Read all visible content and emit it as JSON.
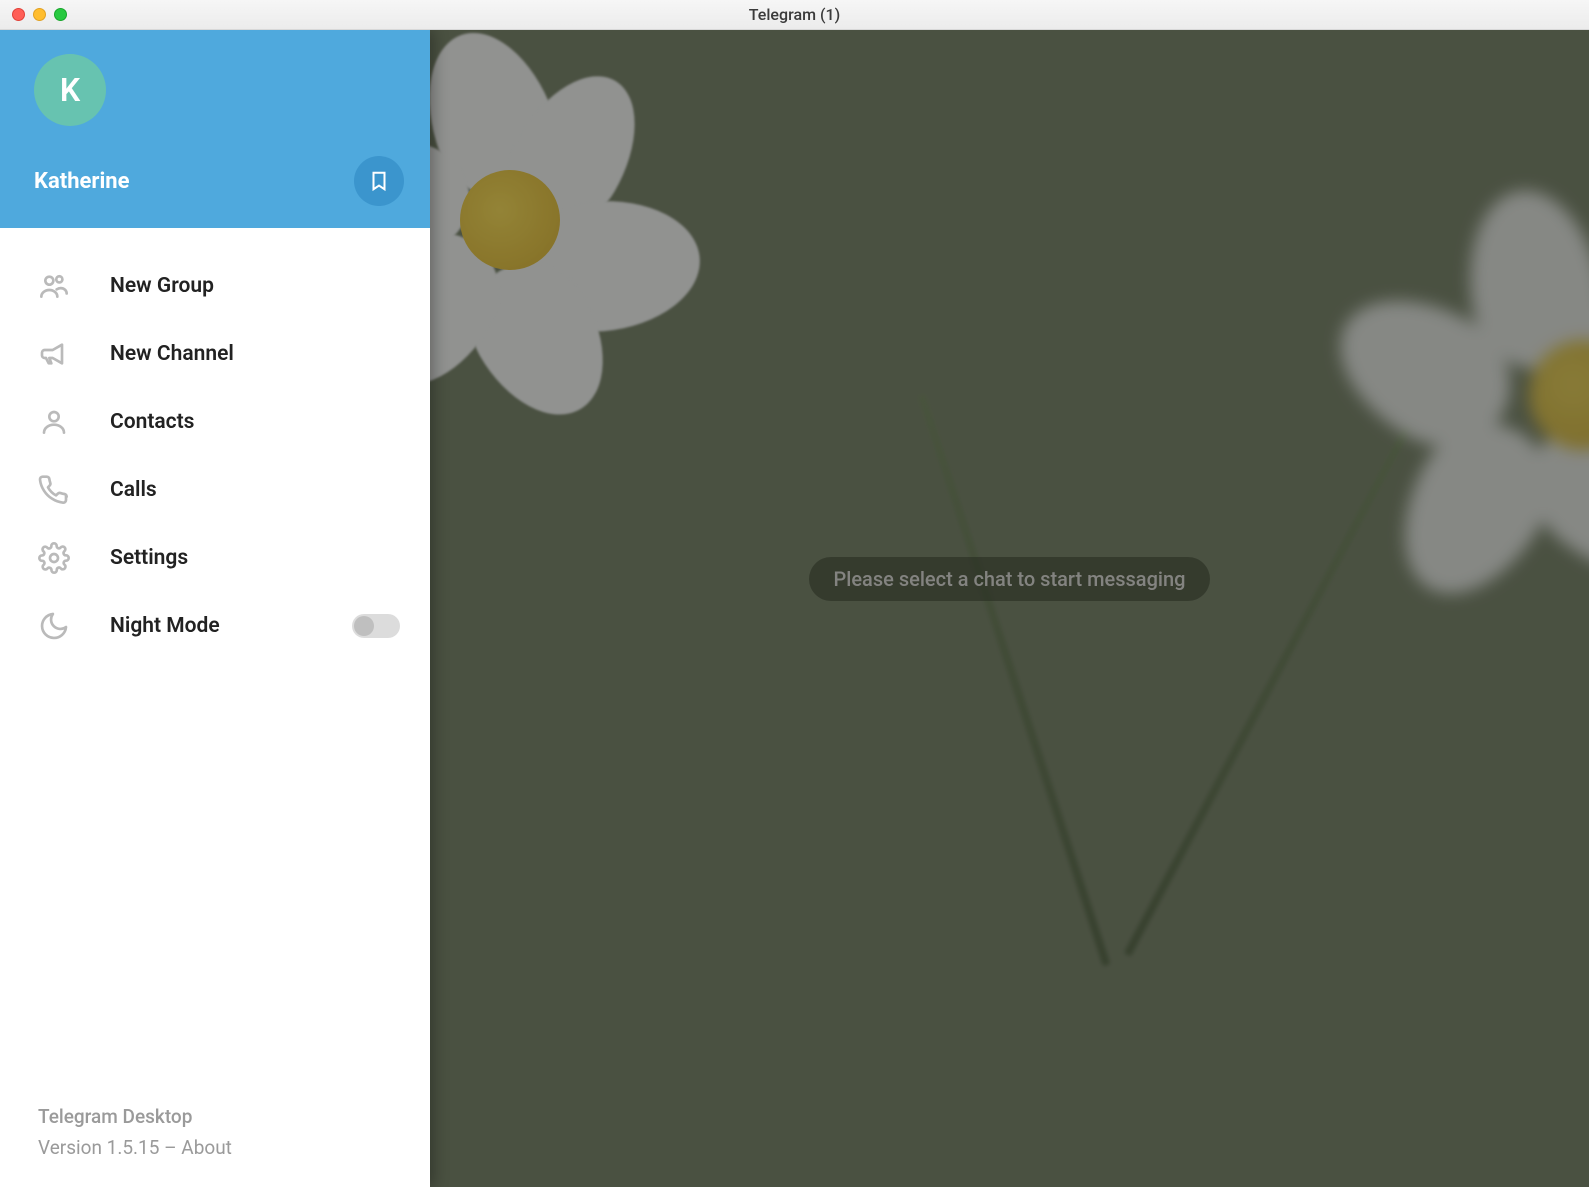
{
  "window": {
    "title": "Telegram (1)"
  },
  "profile": {
    "avatar_initial": "K",
    "username": "Katherine"
  },
  "menu": {
    "new_group": "New Group",
    "new_channel": "New Channel",
    "contacts": "Contacts",
    "calls": "Calls",
    "settings": "Settings",
    "night_mode": "Night Mode"
  },
  "footer": {
    "app_name": "Telegram Desktop",
    "version_line": "Version 1.5.15 – About"
  },
  "content": {
    "placeholder": "Please select a chat to start messaging"
  }
}
